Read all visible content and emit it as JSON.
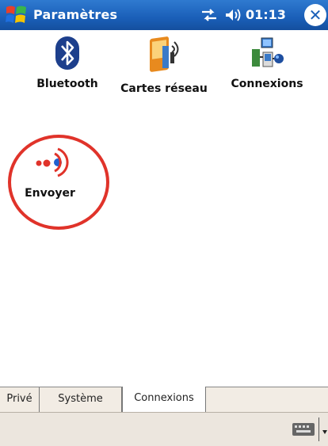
{
  "titlebar": {
    "title": "Paramètres",
    "clock": "01:13",
    "close_glyph": "✕",
    "icons": [
      "windows-start-icon",
      "network-status-icon",
      "speaker-icon",
      "close-icon"
    ]
  },
  "items": [
    {
      "label": "Bluetooth",
      "icon": "bluetooth-icon"
    },
    {
      "label": "Cartes réseau",
      "icon": "network-card-icon"
    },
    {
      "label": "Connexions",
      "icon": "connections-icon"
    },
    {
      "label": "Envoyer",
      "icon": "beam-icon"
    }
  ],
  "tabs": [
    {
      "label": "Privé",
      "selected": false
    },
    {
      "label": "Système",
      "selected": false
    },
    {
      "label": "Connexions",
      "selected": true
    }
  ],
  "colors": {
    "titlebar": "#1a5fb8",
    "highlight": "#e0332a",
    "beam_red": "#e0332a",
    "beam_blue": "#2060d0"
  }
}
